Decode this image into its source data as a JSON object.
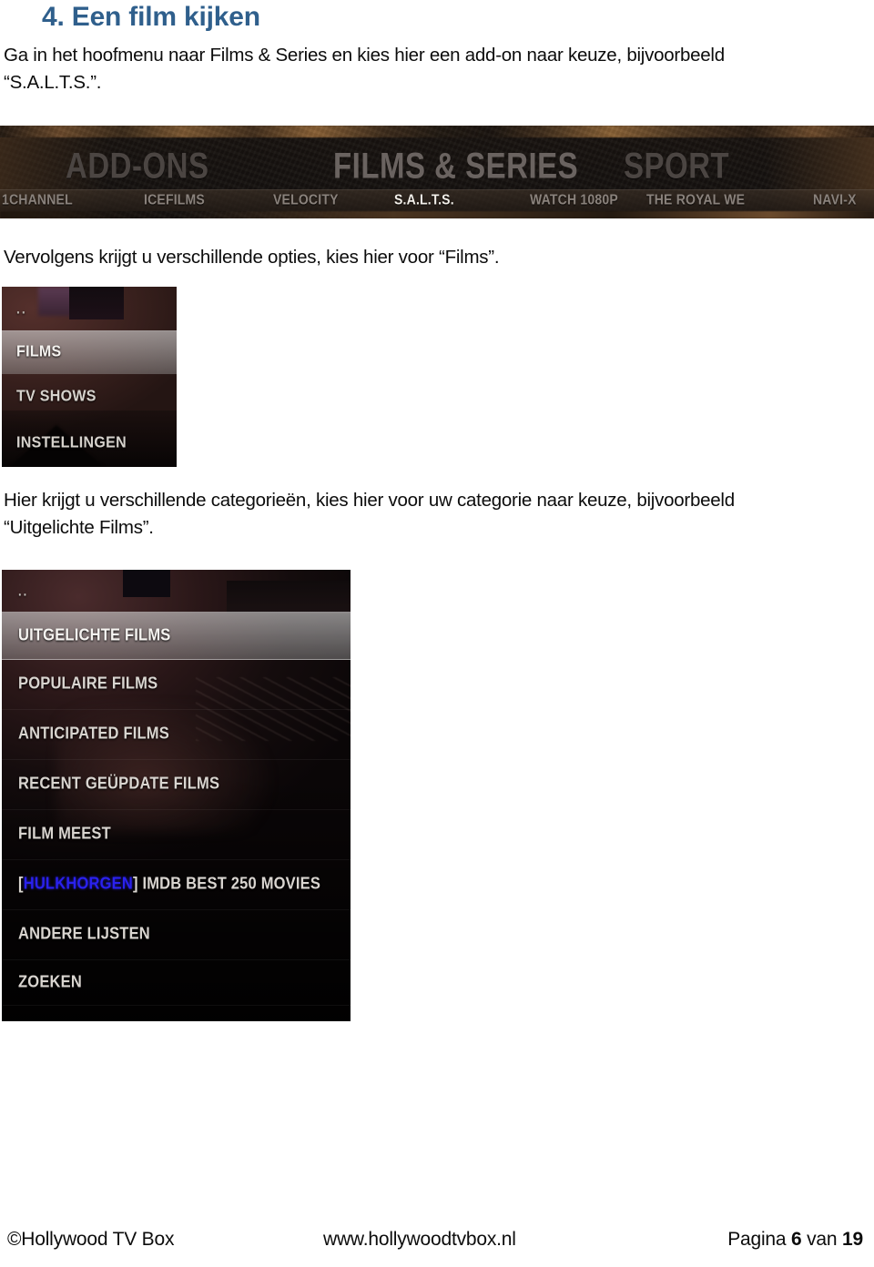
{
  "document": {
    "heading": "4. Een film kijken",
    "paragraph_1": "Ga in het hoofmenu naar Films & Series en kies hier een add-on naar keuze, bijvoorbeeld “S.A.L.T.S.”.",
    "paragraph_2": "Vervolgens krijgt u verschillende opties, kies hier voor “Films”.",
    "paragraph_3": "Hier krijgt u verschillende categorieën, kies hier voor uw categorie naar keuze, bijvoorbeeld “Uitgelichte Films”.",
    "heading_color": "#2f5f8c"
  },
  "screenshot_banner": {
    "main_nav": [
      {
        "label": "ADD-ONS",
        "state": "inactive"
      },
      {
        "label": "FILMS & SERIES",
        "state": "active"
      },
      {
        "label": "SPORT",
        "state": "inactive"
      }
    ],
    "sub_nav": [
      {
        "label": "1CHANNEL",
        "state": "inactive"
      },
      {
        "label": "ICEFILMS",
        "state": "inactive"
      },
      {
        "label": "VELOCITY",
        "state": "inactive"
      },
      {
        "label": "S.A.L.T.S.",
        "state": "active"
      },
      {
        "label": "WATCH 1080P",
        "state": "inactive"
      },
      {
        "label": "THE ROYAL WE",
        "state": "inactive"
      },
      {
        "label": "NAVI-X",
        "state": "inactive"
      }
    ]
  },
  "screenshot_menu": {
    "parent_dir": "..",
    "items": [
      {
        "label": "FILMS",
        "selected": true
      },
      {
        "label": "TV SHOWS",
        "selected": false
      },
      {
        "label": "INSTELLINGEN",
        "selected": false
      }
    ]
  },
  "screenshot_categories": {
    "parent_dir": "..",
    "items": [
      {
        "label": "UITGELICHTE FILMS",
        "selected": true
      },
      {
        "label": "POPULAIRE FILMS",
        "selected": false
      },
      {
        "label": "ANTICIPATED FILMS",
        "selected": false
      },
      {
        "label": "RECENT GEÜPDATE FILMS",
        "selected": false
      },
      {
        "label": "FILM MEEST",
        "selected": false
      },
      {
        "label": "ANDERE LIJSTEN",
        "selected": false
      },
      {
        "label": "ZOEKEN",
        "selected": false
      }
    ],
    "imdb_item": {
      "bracket_open": "[",
      "tag": "HULKHORGEN",
      "bracket_close": "]",
      "rest": " IMDB BEST 250 MOVIES",
      "tag_color": "#2a21ee"
    }
  },
  "footer": {
    "copyright": "©Hollywood TV Box",
    "website": "www.hollywoodtvbox.nl",
    "page_prefix": "Pagina ",
    "page_number": "6",
    "page_middle": " van ",
    "page_total": "19"
  }
}
